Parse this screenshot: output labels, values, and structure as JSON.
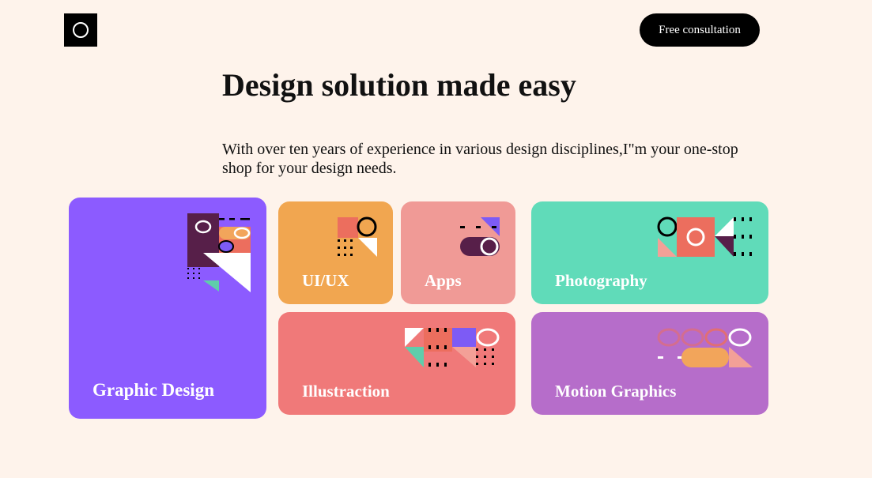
{
  "header": {
    "logo_icon": "ring-icon",
    "cta_label": "Free consultation"
  },
  "hero": {
    "title": "Design solution made easy",
    "description": "With over ten years of experience in various design disciplines,I\"m your one-stop shop for your design needs."
  },
  "services": {
    "graphic_design": {
      "label": "Graphic Design",
      "color": "#8c5bff"
    },
    "uiux": {
      "label": "UI/UX",
      "color": "#f1a650"
    },
    "apps": {
      "label": "Apps",
      "color": "#f09a96"
    },
    "photography": {
      "label": "Photography",
      "color": "#60dbb9"
    },
    "illustration": {
      "label": "Illustraction",
      "color": "#f07979"
    },
    "motion_graphics": {
      "label": "Motion Graphics",
      "color": "#b66dca"
    }
  },
  "palette": {
    "background": "#fef3eb",
    "dark": "#000000",
    "plum": "#571f49",
    "coral": "#ec6e5e",
    "orange": "#f2a55b",
    "violet": "#7d5bf5",
    "teal": "#5fcdab",
    "pink": "#f3a097"
  }
}
